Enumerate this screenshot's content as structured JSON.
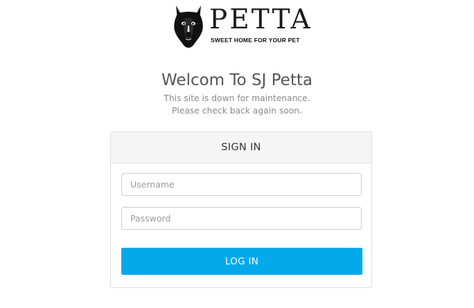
{
  "brand": {
    "logo_text": "PETTA",
    "tagline": "SWEET HOME FOR YOUR PET",
    "logo_icon": "dog-head-icon"
  },
  "heading": {
    "title": "Welcom To SJ Petta",
    "message_line1": "This site is down for maintenance.",
    "message_line2": "Please check back again soon."
  },
  "login_card": {
    "header": "SIGN IN",
    "username": {
      "value": "",
      "placeholder": "Username"
    },
    "password": {
      "value": "",
      "placeholder": "Password"
    },
    "submit_label": "LOG IN"
  },
  "colors": {
    "accent": "#03a9e9",
    "card_header_bg": "#f5f5f5",
    "heading_text": "#555555",
    "muted_text": "#888888"
  }
}
